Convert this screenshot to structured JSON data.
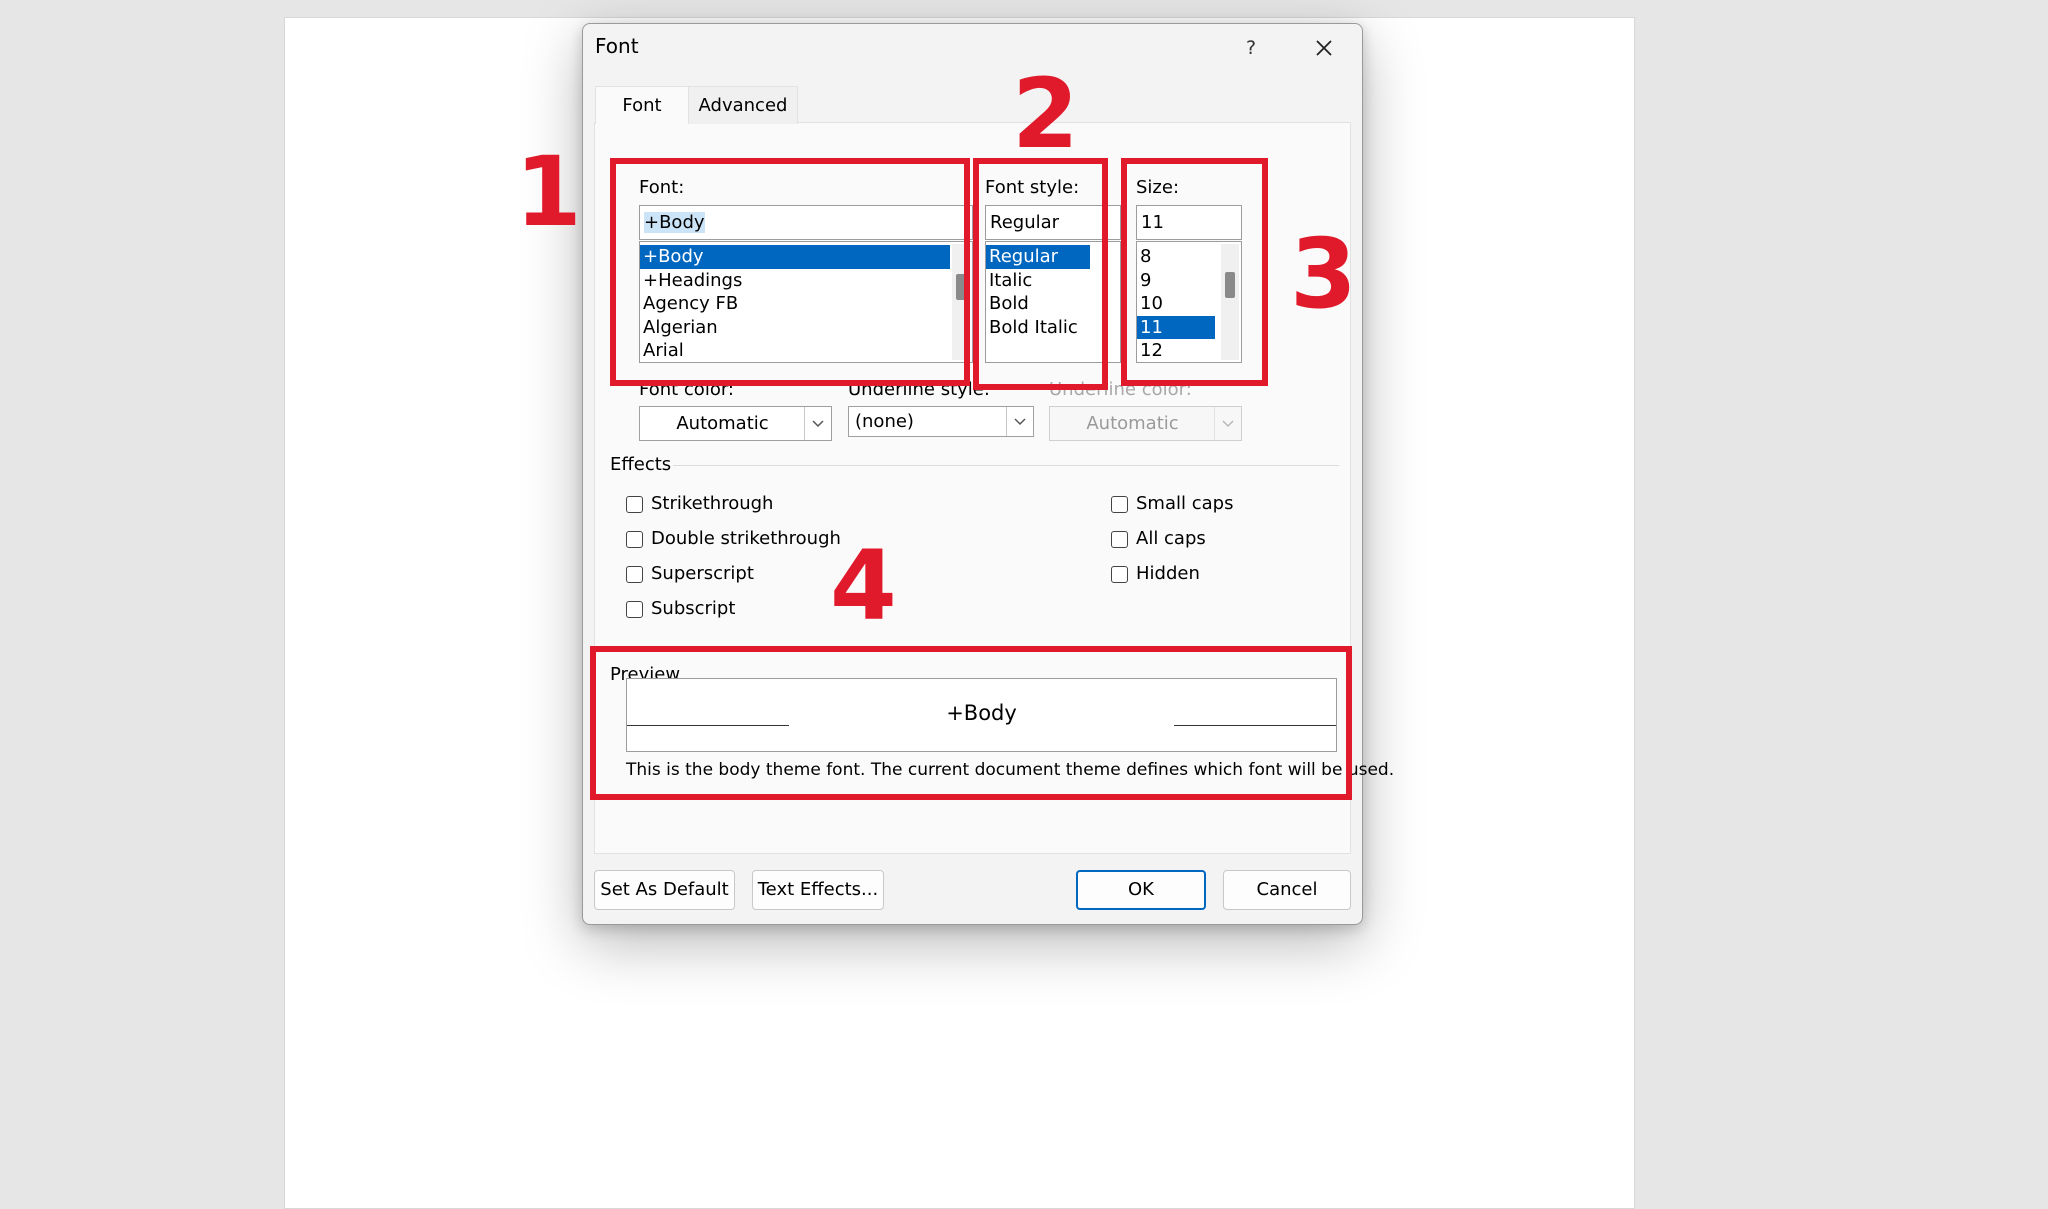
{
  "dialog": {
    "title": "Font",
    "help": "?",
    "tabs": {
      "font": "Font",
      "advanced": "Advanced"
    }
  },
  "font_list": {
    "label": "Font:",
    "value": "+Body",
    "items": [
      "+Body",
      "+Headings",
      "Agency FB",
      "Algerian",
      "Arial"
    ],
    "selected": "+Body"
  },
  "style_list": {
    "label": "Font style:",
    "value": "Regular",
    "items": [
      "Regular",
      "Italic",
      "Bold",
      "Bold Italic"
    ],
    "selected": "Regular"
  },
  "size_list": {
    "label": "Size:",
    "value": "11",
    "items": [
      "8",
      "9",
      "10",
      "11",
      "12"
    ],
    "selected": "11"
  },
  "font_color": {
    "label": "Font color:",
    "value": "Automatic"
  },
  "underline_style": {
    "label": "Underline style:",
    "value": "(none)"
  },
  "underline_color": {
    "label": "Underline color:",
    "value": "Automatic"
  },
  "effects": {
    "label": "Effects",
    "left": [
      "Strikethrough",
      "Double strikethrough",
      "Superscript",
      "Subscript"
    ],
    "right": [
      "Small caps",
      "All caps",
      "Hidden"
    ]
  },
  "preview": {
    "label": "Preview",
    "sample": "+Body",
    "description": "This is the body theme font. The current document theme defines which font will be used."
  },
  "buttons": {
    "set_default": "Set As Default",
    "text_effects": "Text Effects...",
    "ok": "OK",
    "cancel": "Cancel"
  },
  "annotations": [
    "1",
    "2",
    "3",
    "4"
  ],
  "colors": {
    "annotation_red": "#e01a2b",
    "selection_blue": "#0067c0"
  }
}
